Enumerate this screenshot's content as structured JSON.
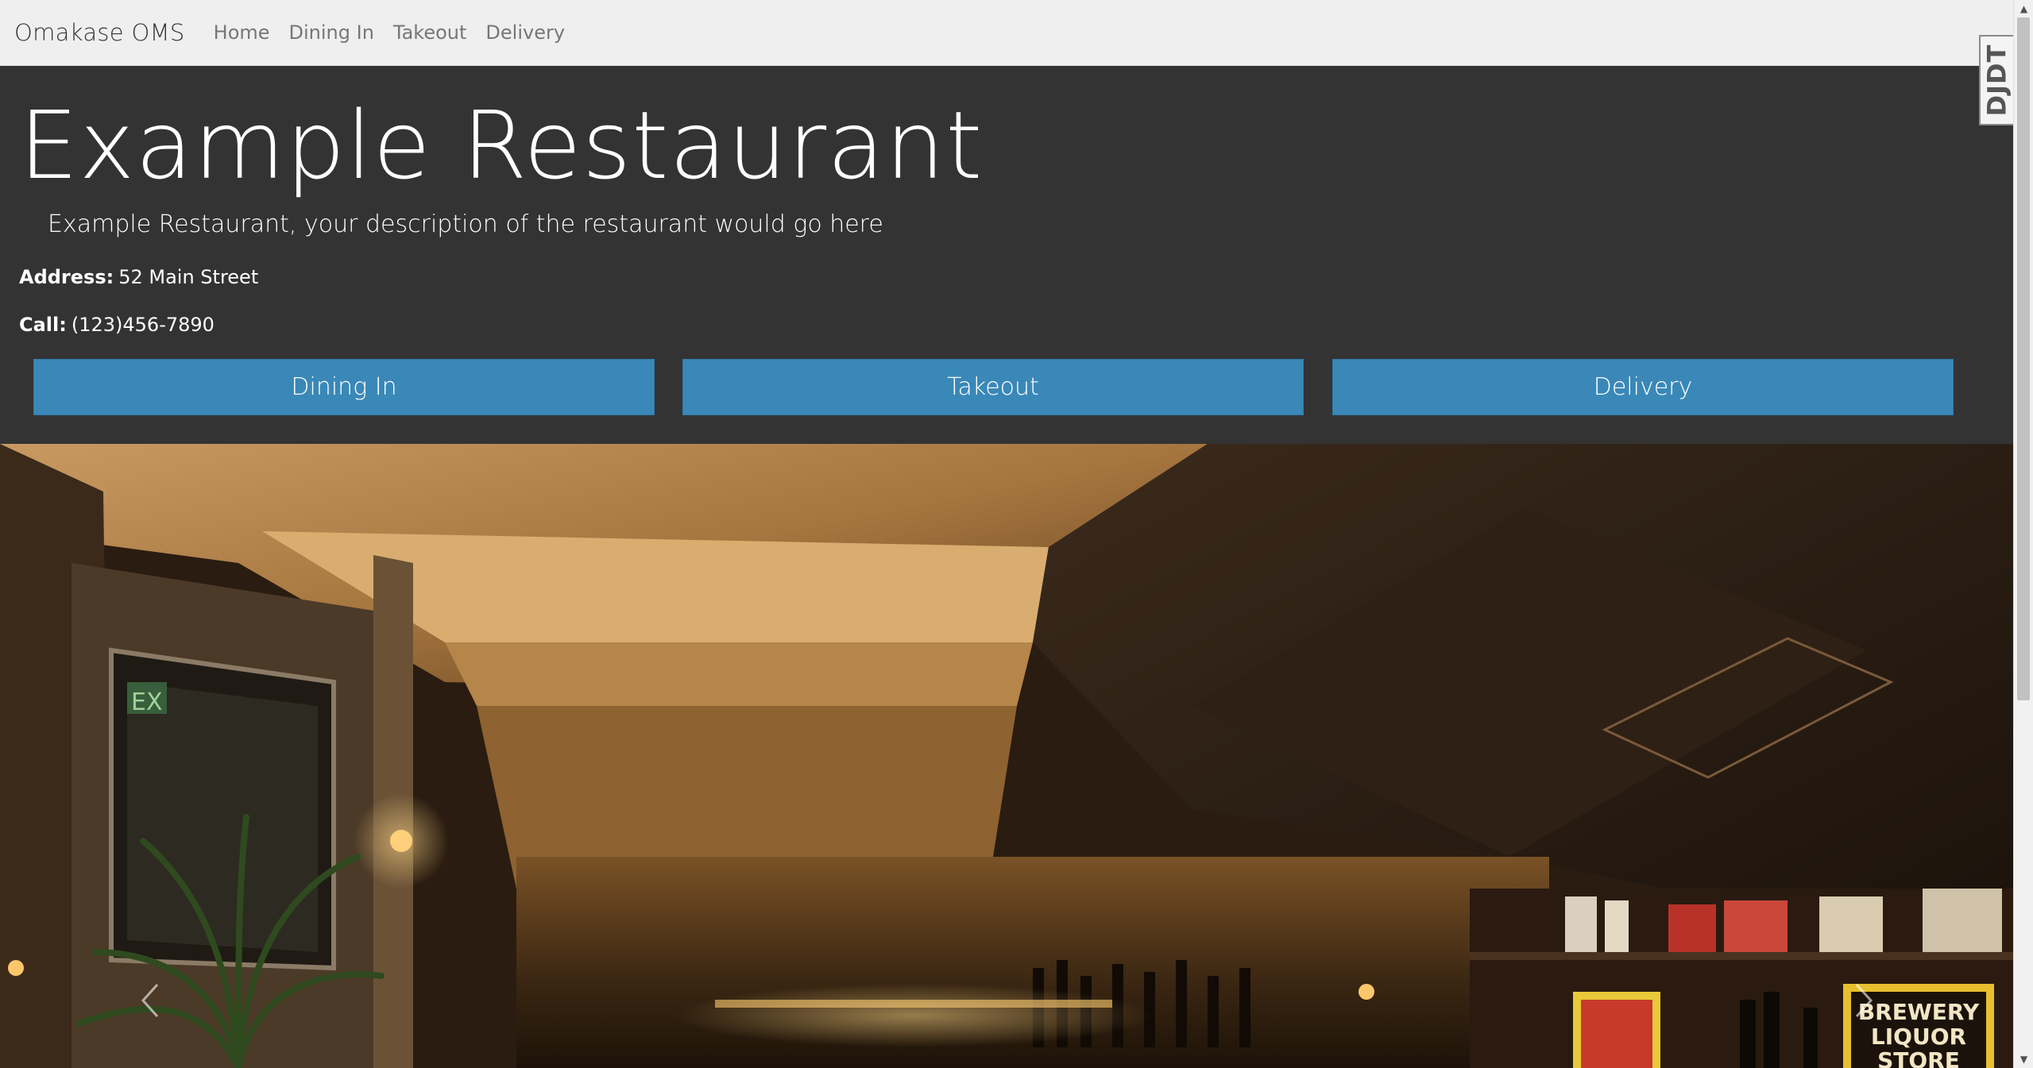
{
  "navbar": {
    "brand": "Omakase OMS",
    "links": [
      "Home",
      "Dining In",
      "Takeout",
      "Delivery"
    ]
  },
  "hero": {
    "title": "Example Restaurant",
    "description": "Example Restaurant, your description of the restaurant would go here",
    "address_label": "Address:",
    "address_value": "52 Main Street",
    "call_label": "Call:",
    "call_value": "(123)456-7890",
    "buttons": [
      "Dining In",
      "Takeout",
      "Delivery"
    ]
  },
  "carousel": {
    "sign_text": [
      "BREWERY",
      "LIQUOR",
      "STORE"
    ],
    "exit_text": "EX"
  },
  "debug_toolbar": {
    "label": "DJDT"
  },
  "colors": {
    "navbar_bg": "#efefef",
    "hero_bg": "#333333",
    "button_bg": "#3a88b8"
  }
}
